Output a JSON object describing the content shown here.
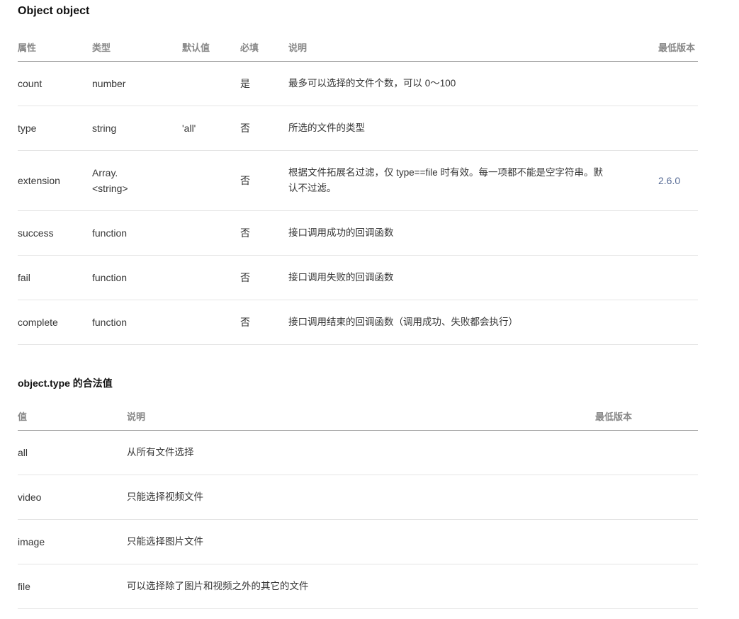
{
  "section1": {
    "title": "Object object",
    "headers": [
      "属性",
      "类型",
      "默认值",
      "必填",
      "说明",
      "最低版本"
    ],
    "rows": [
      {
        "name": "count",
        "type": "number",
        "default": "",
        "required": "是",
        "desc": "最多可以选择的文件个数，可以 0～100",
        "version": ""
      },
      {
        "name": "type",
        "type": "string",
        "default": "'all'",
        "required": "否",
        "desc": "所选的文件的类型",
        "version": ""
      },
      {
        "name": "extension",
        "type_lines": [
          "Array.",
          "<string>"
        ],
        "default": "",
        "required": "否",
        "desc_lines": [
          "根据文件拓展名过滤，仅 type==file 时有效。每一项都不能是空字符串。默",
          "认不过滤。"
        ],
        "version": "2.6.0"
      },
      {
        "name": "success",
        "type": "function",
        "default": "",
        "required": "否",
        "desc": "接口调用成功的回调函数",
        "version": ""
      },
      {
        "name": "fail",
        "type": "function",
        "default": "",
        "required": "否",
        "desc": "接口调用失败的回调函数",
        "version": ""
      },
      {
        "name": "complete",
        "type": "function",
        "default": "",
        "required": "否",
        "desc": "接口调用结束的回调函数（调用成功、失败都会执行）",
        "version": ""
      }
    ]
  },
  "section2": {
    "title": "object.type 的合法值",
    "headers": [
      "值",
      "说明",
      "最低版本"
    ],
    "rows": [
      {
        "value": "all",
        "desc": "从所有文件选择",
        "version": ""
      },
      {
        "value": "video",
        "desc": "只能选择视频文件",
        "version": ""
      },
      {
        "value": "image",
        "desc": "只能选择图片文件",
        "version": ""
      },
      {
        "value": "file",
        "desc": "可以选择除了图片和视频之外的其它的文件",
        "version": ""
      }
    ]
  },
  "colors": {
    "text": "#353535",
    "header": "#888888",
    "divider": "#e5e5e5",
    "version_link": "#576b95"
  }
}
